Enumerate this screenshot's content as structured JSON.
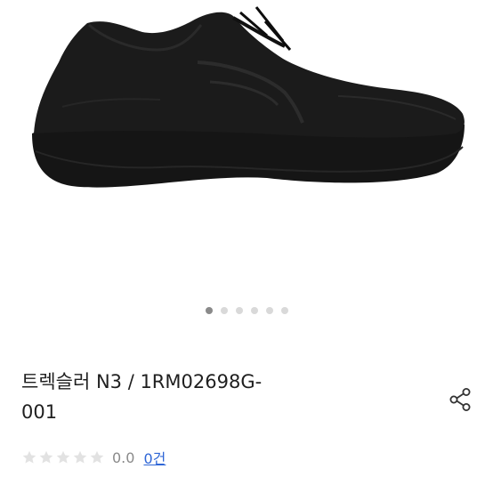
{
  "product": {
    "title_line1": "트렉슬러 N3 / 1RM02698G-",
    "title_line2": "001",
    "rating_value": "0.0",
    "rating_stars": 0,
    "review_count": "0건",
    "image_count": 6,
    "current_image": 1
  },
  "icons": {
    "share": "share-icon",
    "star": "star-icon"
  },
  "colors": {
    "link": "#2f66d6",
    "muted": "#8a8a8a",
    "dot_active": "#8a8a8a",
    "dot_inactive": "#d9d9d9",
    "star_empty": "#e2e2e2"
  }
}
